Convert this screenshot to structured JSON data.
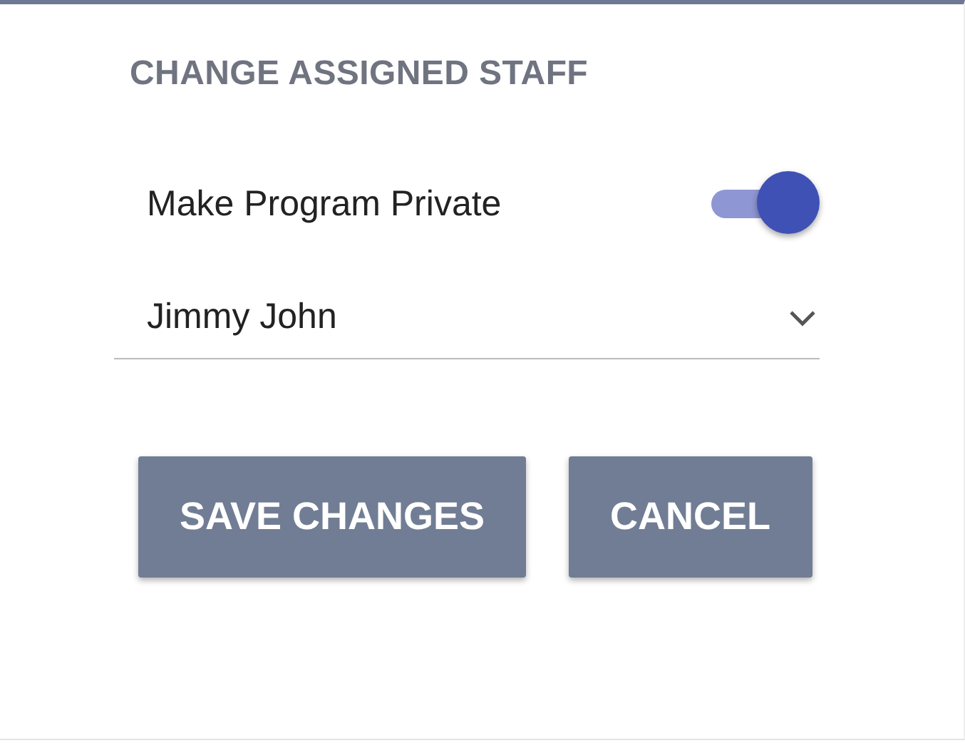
{
  "heading": "CHANGE ASSIGNED STAFF",
  "toggle": {
    "label": "Make Program Private",
    "on": true
  },
  "dropdown": {
    "value": "Jimmy John"
  },
  "buttons": [
    {
      "label": "SAVE CHANGES"
    },
    {
      "label": "CANCEL"
    }
  ]
}
